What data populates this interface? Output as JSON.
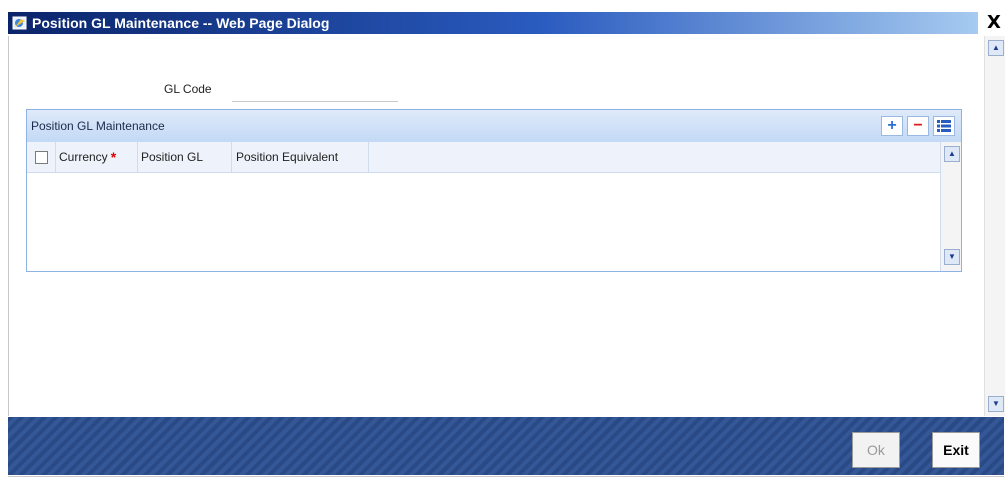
{
  "window": {
    "title": "Position GL Maintenance -- Web Page Dialog",
    "close_label": "X"
  },
  "form": {
    "gl_code_label": "GL Code",
    "gl_code_value": ""
  },
  "grid": {
    "title": "Position GL Maintenance",
    "columns": [
      {
        "label": "Currency",
        "required": true
      },
      {
        "label": "Position GL",
        "required": false
      },
      {
        "label": "Position Equivalent",
        "required": false
      }
    ],
    "required_marker": "*",
    "rows": [],
    "tools": {
      "add": "+",
      "delete": "−"
    }
  },
  "footer": {
    "ok_label": "Ok",
    "exit_label": "Exit"
  },
  "colors": {
    "title_bar": "#0a246a",
    "grid_header": "#c3d9f6",
    "footer": "#2a4a86",
    "required": "#e00000"
  }
}
